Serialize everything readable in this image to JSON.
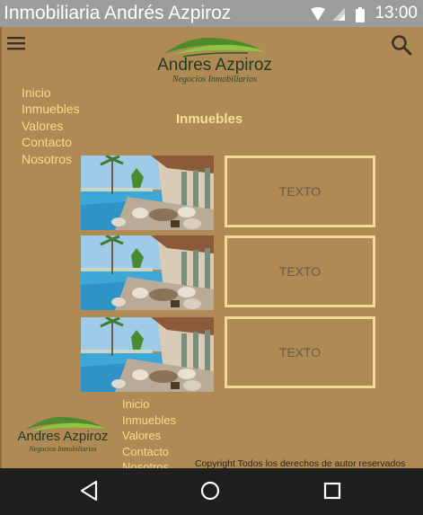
{
  "status_bar": {
    "app_title": "Inmobiliaria Andrés Azpiroz",
    "time": "13:00",
    "icons": [
      "wifi-icon",
      "signal-icon",
      "battery-icon"
    ]
  },
  "header": {
    "menu_icon": "hamburger-menu-icon",
    "search_icon": "search-icon",
    "logo_name": "Andres Azpiroz",
    "logo_tagline": "Negocios Inmobiliarios"
  },
  "side_nav": {
    "items": [
      "Inicio",
      "Inmuebles",
      "Valores",
      "Contacto",
      "Nosotros"
    ]
  },
  "main": {
    "section_title": "Inmuebles",
    "properties": [
      {
        "text": "TEXTO",
        "image": "pool-terrace-photo"
      },
      {
        "text": "TEXTO",
        "image": "pool-terrace-photo"
      },
      {
        "text": "TEXTO",
        "image": "pool-terrace-photo"
      }
    ]
  },
  "footer": {
    "logo_name": "Andres Azpiroz",
    "logo_tagline": "Negocios Inmobiliarios",
    "nav": [
      "Inicio",
      "Inmuebles",
      "Valores",
      "Contacto",
      "Nosotros"
    ],
    "copyright": "Copyright Todos los derechos de autor reservados"
  },
  "system_nav": {
    "icons": [
      "back-icon",
      "home-icon",
      "recents-icon"
    ]
  },
  "colors": {
    "background": "#b08a54",
    "nav_link": "#f7dc8c",
    "card_border": "#f2d998",
    "status_bar": "#9c9c9c",
    "system_nav": "#1f1f1f",
    "logo_green": "#1f3b25"
  }
}
